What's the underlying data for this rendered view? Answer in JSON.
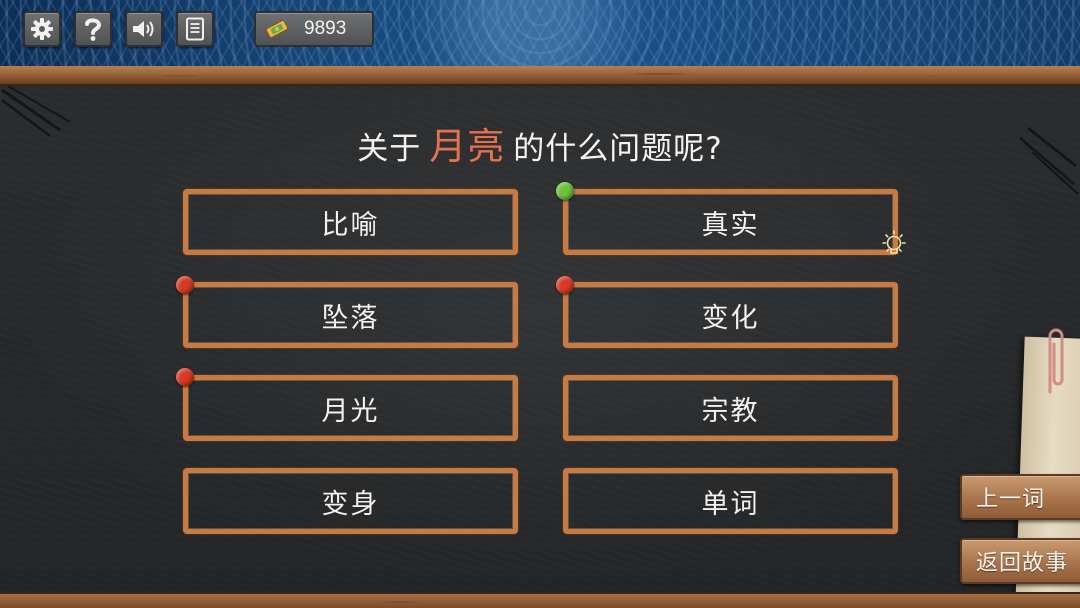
{
  "hud": {
    "settings_icon": "gear-icon",
    "help_icon": "question-icon",
    "sound_icon": "speaker-icon",
    "notes_icon": "notebook-icon",
    "currency_icon": "ticket-coin-icon",
    "currency_value": "9893"
  },
  "question": {
    "prefix": "关于",
    "keyword": "月亮",
    "suffix": "的什么问题呢?",
    "keyword_color": "#e5714f"
  },
  "answers": [
    {
      "label": "比喻",
      "pin": "none"
    },
    {
      "label": "真实",
      "pin": "green"
    },
    {
      "label": "坠落",
      "pin": "red"
    },
    {
      "label": "变化",
      "pin": "red"
    },
    {
      "label": "月光",
      "pin": "red"
    },
    {
      "label": "宗教",
      "pin": "none"
    },
    {
      "label": "变身",
      "pin": "none"
    },
    {
      "label": "单词",
      "pin": "none"
    }
  ],
  "hint_icon": "lightbulb-icon",
  "side_buttons": {
    "previous_word": "上一词",
    "back_to_story": "返回故事"
  },
  "colors": {
    "board": "#26282a",
    "answer_border": "#c87a42",
    "pin_green": "#6cc23d",
    "pin_red": "#d83a24",
    "banner": "#174a7e"
  }
}
